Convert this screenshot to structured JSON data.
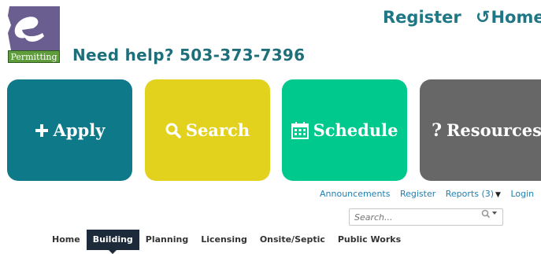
{
  "logo": {
    "badge_text": "Permitting",
    "mark_letter": "e"
  },
  "help_text": "Need help? 503-373-7396",
  "top_links": {
    "register": "Register",
    "home": "Home",
    "home_icon": "↺"
  },
  "tiles": [
    {
      "label": "Apply",
      "icon": "plus-icon",
      "color": "#0e7989"
    },
    {
      "label": "Search",
      "icon": "search-icon",
      "color": "#e3d21d"
    },
    {
      "label": "Schedule",
      "icon": "calendar-icon",
      "color": "#00c98d"
    },
    {
      "label": "Resources",
      "icon": "question-icon",
      "color": "#676767"
    }
  ],
  "util_links": {
    "announcements": "Announcements",
    "register": "Register",
    "reports": "Reports (3)",
    "login": "Login"
  },
  "search": {
    "placeholder": "Search..."
  },
  "nav": {
    "items": [
      "Home",
      "Building",
      "Planning",
      "Licensing",
      "Onsite/Septic",
      "Public Works"
    ],
    "active": "Building"
  },
  "colors": {
    "brand_teal": "#1f6f7a",
    "nav_active": "#1c2a3a",
    "logo_purple": "#6a5d8f",
    "logo_green": "#5e9c3c"
  }
}
